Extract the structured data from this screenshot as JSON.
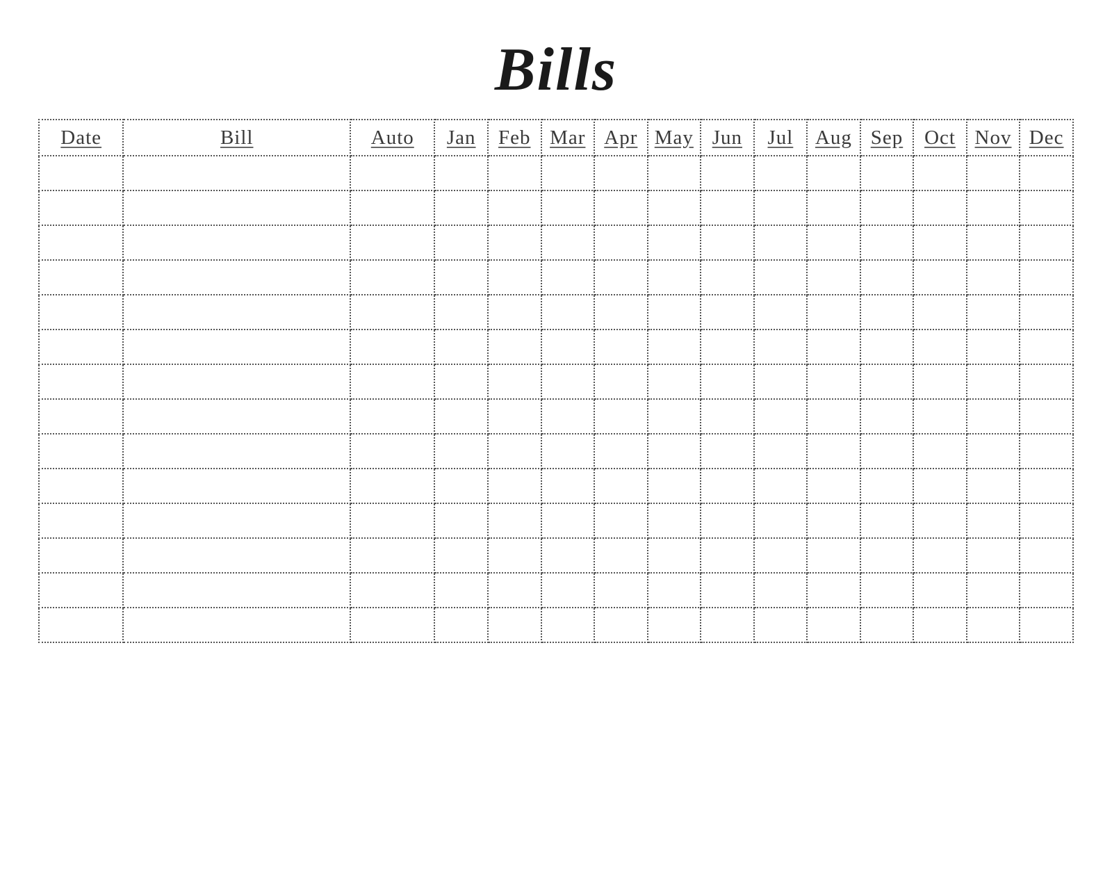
{
  "title": "Bills",
  "columns": [
    "Date",
    "Bill",
    "Auto",
    "Jan",
    "Feb",
    "Mar",
    "Apr",
    "May",
    "Jun",
    "Jul",
    "Aug",
    "Sep",
    "Oct",
    "Nov",
    "Dec"
  ],
  "rowCount": 14
}
